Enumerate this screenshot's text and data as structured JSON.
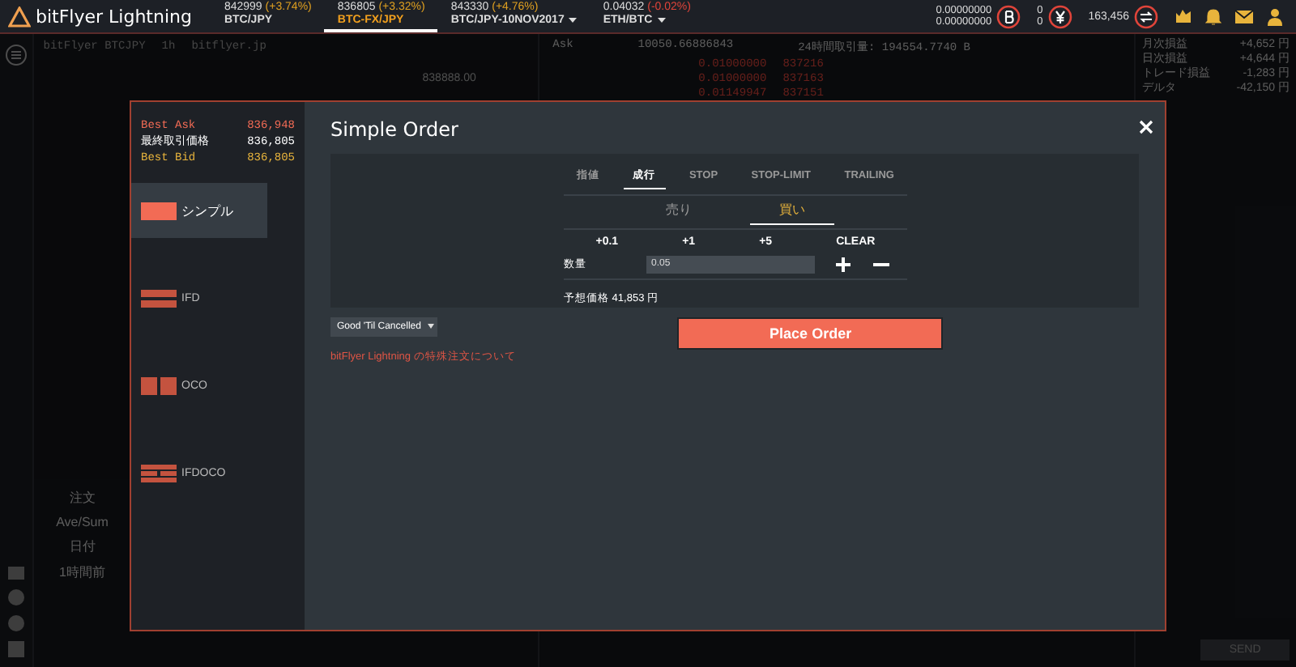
{
  "top_bar": {
    "logo": "bitFlyer Lightning",
    "markets": [
      {
        "price": "842999",
        "change": "(+3.74%)",
        "color": "#e0a020",
        "pair": "BTC/JPY",
        "selected": false,
        "dropdown": false
      },
      {
        "price": "836805",
        "change": "(+3.32%)",
        "color": "#e0a020",
        "pair": "BTC-FX/JPY",
        "selected": true,
        "dropdown": false
      },
      {
        "price": "843330",
        "change": "(+4.76%)",
        "color": "#e0a020",
        "pair": "BTC/JPY-10NOV2017",
        "selected": false,
        "dropdown": true
      },
      {
        "price": "0.04032",
        "change": "(-0.02%)",
        "color": "#e0443a",
        "pair": "ETH/BTC",
        "selected": false,
        "dropdown": true
      }
    ],
    "btc_balance": [
      "0.00000000",
      "0.00000000"
    ],
    "jpy_balance": [
      "0",
      "0"
    ],
    "collateral": "163,456"
  },
  "background": {
    "chart_header": [
      "bitFlyer BTCJPY",
      "1h",
      "bitflyer.jp"
    ],
    "chart_price": "838888.00",
    "order_book": {
      "side": "Ask",
      "size": "10050.66886843",
      "volume": "24時間取引量: 194554.7740 B",
      "rows": [
        {
          "amount": "0.01000000",
          "price": "837216"
        },
        {
          "amount": "0.01000000",
          "price": "837163"
        },
        {
          "amount": "0.01149947",
          "price": "837151"
        }
      ]
    },
    "pnl": [
      {
        "label": "月次損益",
        "value": "+4,652 円"
      },
      {
        "label": "日次損益",
        "value": "+4,644 円"
      },
      {
        "label": "トレード損益",
        "value": "-1,283 円"
      },
      {
        "label": "デルタ",
        "value": "-42,150 円"
      }
    ],
    "left_panel": {
      "tab": "注文",
      "items": [
        "Ave/Sum",
        "日付",
        "1時間前"
      ]
    },
    "send": "SEND"
  },
  "modal": {
    "quotes": [
      {
        "kind": "ask",
        "label": "Best Ask",
        "value": "836,948"
      },
      {
        "kind": "last",
        "label": "最終取引価格",
        "value": "836,805"
      },
      {
        "kind": "bid",
        "label": "Best Bid",
        "value": "836,805"
      }
    ],
    "order_types": [
      {
        "label": "シンプル",
        "kind": "simple",
        "selected": true
      },
      {
        "label": "IFD",
        "kind": "ifd",
        "selected": false
      },
      {
        "label": "OCO",
        "kind": "oco",
        "selected": false
      },
      {
        "label": "IFDOCO",
        "kind": "ifdoco",
        "selected": false
      }
    ],
    "title": "Simple Order",
    "tabs": [
      {
        "label": "指値",
        "selected": false
      },
      {
        "label": "成行",
        "selected": true
      },
      {
        "label": "STOP",
        "selected": false
      },
      {
        "label": "STOP-LIMIT",
        "selected": false
      },
      {
        "label": "TRAILING",
        "selected": false
      }
    ],
    "sides": [
      {
        "label": "売り",
        "selected": false
      },
      {
        "label": "買い",
        "selected": true
      }
    ],
    "quick_buttons": [
      "+0.1",
      "+1",
      "+5",
      "CLEAR"
    ],
    "quantity": {
      "label": "数量",
      "value": "0.05"
    },
    "estimate": "予想価格 41,853 円",
    "time_in_force": "Good 'Til Cancelled",
    "submit": "Place Order",
    "link": "bitFlyer Lightning の特殊注文について"
  }
}
